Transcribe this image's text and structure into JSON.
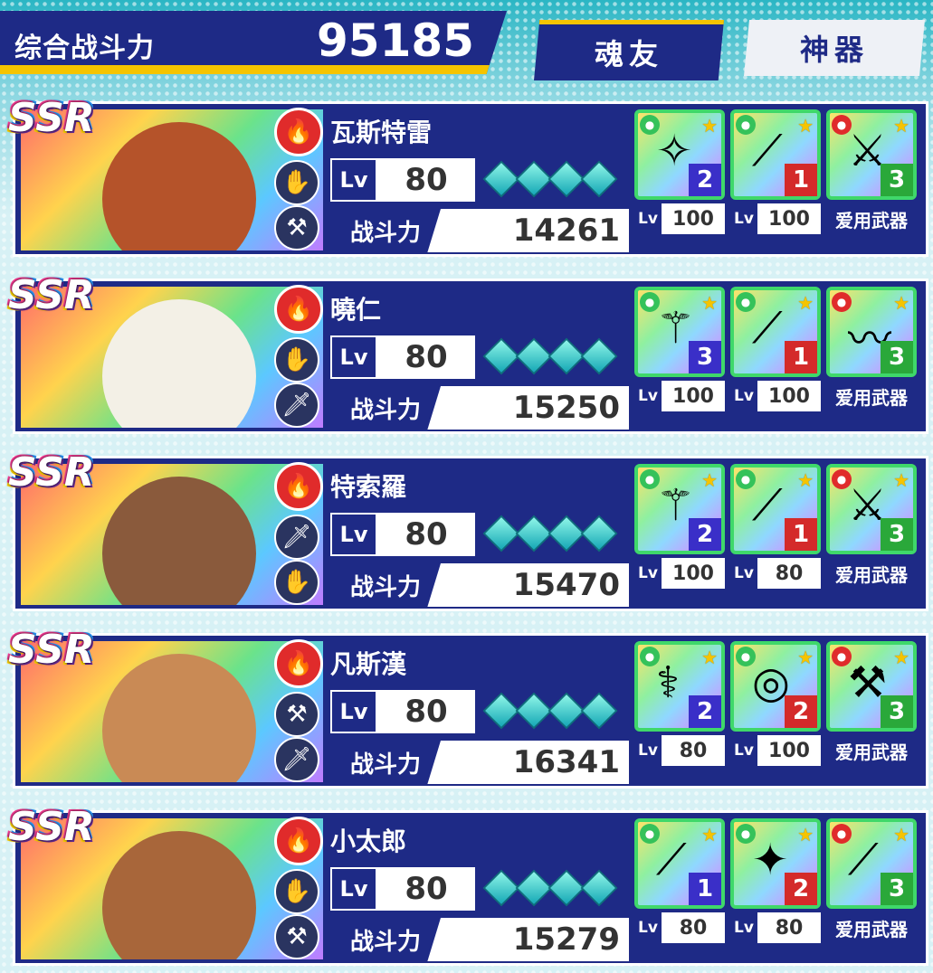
{
  "header": {
    "power_label": "综合战斗力",
    "power_value": "95185",
    "tabs": [
      {
        "label": "魂友",
        "active": true
      },
      {
        "label": "神器",
        "active": false
      }
    ]
  },
  "rarity_label": "SSR",
  "lv_label": "Lv",
  "cp_label": "战斗力",
  "fav_label": "爱用武器",
  "characters": [
    {
      "name": "瓦斯特雷",
      "level": "80",
      "power": "14261",
      "portrait_color": "#b5532a",
      "class_icons": [
        "gauntlet-icon",
        "axe-icon"
      ],
      "equips": [
        {
          "icon": "winged-orb-icon",
          "rank": "2",
          "rank_color": "blue",
          "lv": "100"
        },
        {
          "icon": "spear-icon",
          "rank": "1",
          "rank_color": "red",
          "lv": "100"
        },
        {
          "icon": "claw-gauntlet-icon",
          "rank": "3",
          "rank_color": "green",
          "fav": true
        }
      ]
    },
    {
      "name": "曉仁",
      "level": "80",
      "power": "15250",
      "portrait_color": "#f3f0e6",
      "class_icons": [
        "gauntlet-icon",
        "sword-icon"
      ],
      "equips": [
        {
          "icon": "staff-icon",
          "rank": "3",
          "rank_color": "blue",
          "lv": "100"
        },
        {
          "icon": "green-blade-icon",
          "rank": "1",
          "rank_color": "red",
          "lv": "100"
        },
        {
          "icon": "headband-icon",
          "rank": "3",
          "rank_color": "green",
          "fav": true
        }
      ]
    },
    {
      "name": "特索羅",
      "level": "80",
      "power": "15470",
      "portrait_color": "#8a5a3c",
      "class_icons": [
        "sword-icon",
        "gauntlet-icon"
      ],
      "equips": [
        {
          "icon": "winged-staff-icon",
          "rank": "2",
          "rank_color": "blue",
          "lv": "100"
        },
        {
          "icon": "green-blade-icon",
          "rank": "1",
          "rank_color": "red",
          "lv": "80"
        },
        {
          "icon": "crossed-swords-icon",
          "rank": "3",
          "rank_color": "green",
          "fav": true
        }
      ]
    },
    {
      "name": "凡斯漢",
      "level": "80",
      "power": "16341",
      "portrait_color": "#c98a55",
      "class_icons": [
        "axe-icon",
        "sword-icon"
      ],
      "equips": [
        {
          "icon": "curved-staff-icon",
          "rank": "2",
          "rank_color": "blue",
          "lv": "80"
        },
        {
          "icon": "circlet-icon",
          "rank": "2",
          "rank_color": "red",
          "lv": "100"
        },
        {
          "icon": "battle-axe-icon",
          "rank": "3",
          "rank_color": "green",
          "fav": true
        }
      ]
    },
    {
      "name": "小太郎",
      "level": "80",
      "power": "15279",
      "portrait_color": "#a8663a",
      "class_icons": [
        "gauntlet-icon",
        "axe-icon"
      ],
      "equips": [
        {
          "icon": "spear-icon",
          "rank": "1",
          "rank_color": "blue",
          "lv": "80"
        },
        {
          "icon": "feathered-blade-icon",
          "rank": "2",
          "rank_color": "red",
          "lv": "80"
        },
        {
          "icon": "bat-icon",
          "rank": "3",
          "rank_color": "green",
          "fav": true
        }
      ]
    }
  ]
}
